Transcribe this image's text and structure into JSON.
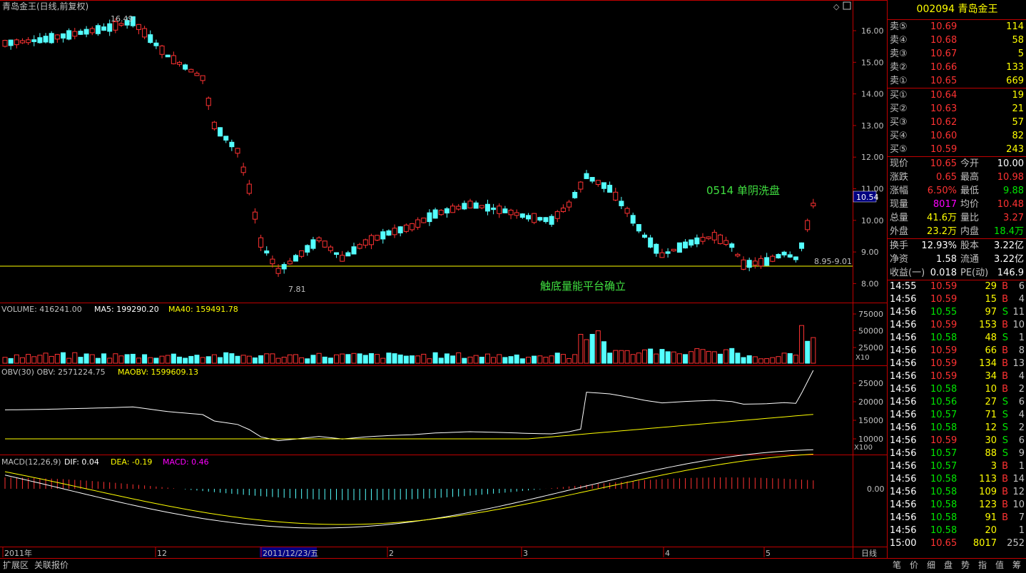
{
  "chart_header": {
    "title": "青岛金王(日线,前复权)",
    "high_label": "16.49",
    "low_label": "7.81",
    "range_label": "8.95-9.01",
    "price_tag": "10.54",
    "annotation_1": "0514 单阴洗盘",
    "annotation_2": "触底量能平台确立",
    "daily_label": "日线"
  },
  "price_axis": [
    "16.00",
    "15.00",
    "14.00",
    "13.00",
    "12.00",
    "11.00",
    "10.00",
    "9.00",
    "8.00"
  ],
  "volume": {
    "label": "VOLUME: 416241.00",
    "ma5": "MA5: 199290.20",
    "ma40": "MA40: 159491.78",
    "ticks": [
      "75000",
      "50000",
      "25000"
    ],
    "unit": "X10"
  },
  "obv": {
    "label": "OBV(30)  OBV: 2571224.75",
    "maobv": "MAOBV: 1599609.13",
    "ticks": [
      "25000",
      "20000",
      "15000",
      "10000"
    ],
    "unit": "X100"
  },
  "macd": {
    "label": "MACD(12,26,9)",
    "dif": "DIF: 0.04",
    "dea": "DEA: -0.19",
    "macd": "MACD: 0.46",
    "zero": "0.00"
  },
  "date_axis": [
    "2011年",
    "12",
    "2011/12/23/五",
    "2",
    "3",
    "4",
    "5"
  ],
  "colors": {
    "up": "#ff3232",
    "down": "#54ffff",
    "yellow": "#ffff00",
    "white": "#ffffff",
    "magenta": "#ff00ff",
    "green": "#00e600",
    "axis": "#c00000"
  },
  "sidebar": {
    "code_name": "002094 青岛金王",
    "asks": [
      {
        "label": "卖⑤",
        "price": "10.69",
        "vol": "114"
      },
      {
        "label": "卖④",
        "price": "10.68",
        "vol": "58"
      },
      {
        "label": "卖③",
        "price": "10.67",
        "vol": "5"
      },
      {
        "label": "卖②",
        "price": "10.66",
        "vol": "133"
      },
      {
        "label": "卖①",
        "price": "10.65",
        "vol": "669"
      }
    ],
    "bids": [
      {
        "label": "买①",
        "price": "10.64",
        "vol": "19"
      },
      {
        "label": "买②",
        "price": "10.63",
        "vol": "21"
      },
      {
        "label": "买③",
        "price": "10.62",
        "vol": "57"
      },
      {
        "label": "买④",
        "price": "10.60",
        "vol": "82"
      },
      {
        "label": "买⑤",
        "price": "10.59",
        "vol": "243"
      }
    ],
    "quote": [
      {
        "k1": "现价",
        "v1": "10.65",
        "k2": "今开",
        "v2": "10.00"
      },
      {
        "k1": "涨跌",
        "v1": "0.65",
        "k2": "最高",
        "v2": "10.98"
      },
      {
        "k1": "涨幅",
        "v1": "6.50%",
        "k2": "最低",
        "v2": "9.88"
      },
      {
        "k1": "现量",
        "v1": "8017",
        "k2": "均价",
        "v2": "10.48"
      },
      {
        "k1": "总量",
        "v1": "41.6万",
        "k2": "量比",
        "v2": "3.27"
      },
      {
        "k1": "外盘",
        "v1": "23.2万",
        "k2": "内盘",
        "v2": "18.4万"
      }
    ],
    "info": [
      {
        "k1": "换手",
        "v1": "12.93%",
        "k2": "股本",
        "v2": "3.22亿"
      },
      {
        "k1": "净资",
        "v1": "1.58",
        "k2": "流通",
        "v2": "3.22亿"
      },
      {
        "k1": "收益(一)",
        "v1": "0.018",
        "k2": "PE(动)",
        "v2": "146.9"
      }
    ],
    "ticks": [
      {
        "t": "14:55",
        "p": "10.59",
        "v": "29",
        "bs": "B",
        "n": "6"
      },
      {
        "t": "14:56",
        "p": "10.59",
        "v": "15",
        "bs": "B",
        "n": "4"
      },
      {
        "t": "14:56",
        "p": "10.55",
        "v": "97",
        "bs": "S",
        "n": "11"
      },
      {
        "t": "14:56",
        "p": "10.59",
        "v": "153",
        "bs": "B",
        "n": "10"
      },
      {
        "t": "14:56",
        "p": "10.58",
        "v": "48",
        "bs": "S",
        "n": "1"
      },
      {
        "t": "14:56",
        "p": "10.59",
        "v": "66",
        "bs": "B",
        "n": "8"
      },
      {
        "t": "14:56",
        "p": "10.59",
        "v": "134",
        "bs": "B",
        "n": "13"
      },
      {
        "t": "14:56",
        "p": "10.59",
        "v": "34",
        "bs": "B",
        "n": "4"
      },
      {
        "t": "14:56",
        "p": "10.58",
        "v": "10",
        "bs": "B",
        "n": "2"
      },
      {
        "t": "14:56",
        "p": "10.56",
        "v": "27",
        "bs": "S",
        "n": "6"
      },
      {
        "t": "14:56",
        "p": "10.57",
        "v": "71",
        "bs": "S",
        "n": "4"
      },
      {
        "t": "14:56",
        "p": "10.58",
        "v": "12",
        "bs": "S",
        "n": "2"
      },
      {
        "t": "14:56",
        "p": "10.59",
        "v": "30",
        "bs": "S",
        "n": "6"
      },
      {
        "t": "14:56",
        "p": "10.57",
        "v": "88",
        "bs": "S",
        "n": "9"
      },
      {
        "t": "14:56",
        "p": "10.57",
        "v": "3",
        "bs": "B",
        "n": "1"
      },
      {
        "t": "14:56",
        "p": "10.58",
        "v": "113",
        "bs": "B",
        "n": "14"
      },
      {
        "t": "14:56",
        "p": "10.58",
        "v": "109",
        "bs": "B",
        "n": "12"
      },
      {
        "t": "14:56",
        "p": "10.58",
        "v": "123",
        "bs": "B",
        "n": "10"
      },
      {
        "t": "14:56",
        "p": "10.58",
        "v": "91",
        "bs": "B",
        "n": "7"
      },
      {
        "t": "14:56",
        "p": "10.58",
        "v": "20",
        "bs": "",
        "n": "1"
      },
      {
        "t": "15:00",
        "p": "10.65",
        "v": "8017",
        "bs": "",
        "n": "252"
      }
    ]
  },
  "bottom_tabs": [
    "扩展区",
    "关联报价"
  ],
  "right_tabs": [
    "笔",
    "价",
    "细",
    "盘",
    "势",
    "指",
    "值",
    "筹"
  ]
}
